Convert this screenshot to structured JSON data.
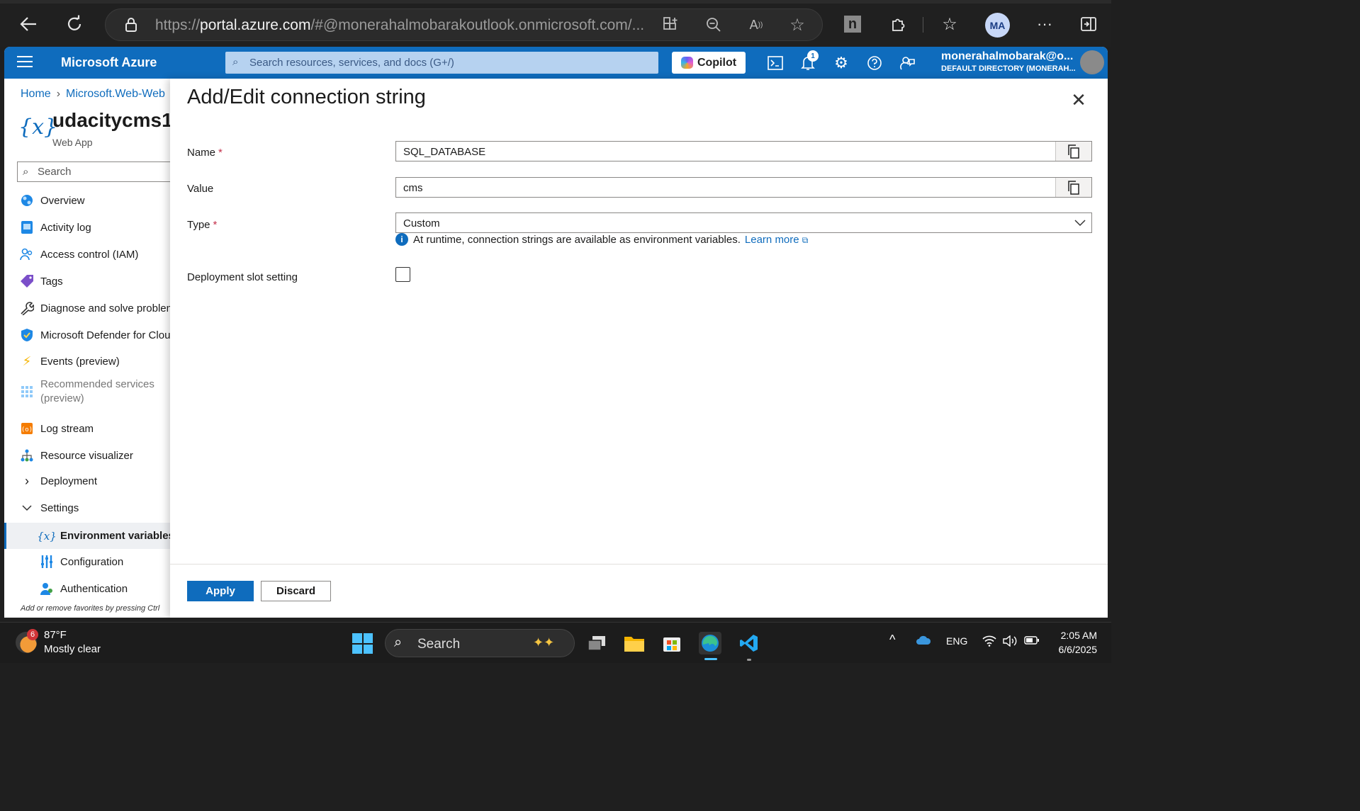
{
  "browser": {
    "url_prefix": "https://",
    "url_host": "portal.azure.com",
    "url_rest": "/#@monerahalmobarakoutlook.onmicrosoft.com/...",
    "profile_initials": "MA"
  },
  "header": {
    "brand": "Microsoft Azure",
    "search_placeholder": "Search resources, services, and docs (G+/)",
    "copilot_label": "Copilot",
    "notification_count": "1",
    "user_email": "monerahalmobarak@o...",
    "user_directory": "DEFAULT DIRECTORY (MONERAH..."
  },
  "breadcrumb": {
    "home": "Home",
    "resource_group": "Microsoft.Web-Web"
  },
  "resource": {
    "title": "udacitycms1 |",
    "subtitle": "Web App",
    "icon_glyph": "{x}"
  },
  "left_search": {
    "placeholder": "Search"
  },
  "nav": {
    "items": [
      {
        "label": "Overview",
        "icon": "globe-icon"
      },
      {
        "label": "Activity log",
        "icon": "activity-log-icon"
      },
      {
        "label": "Access control (IAM)",
        "icon": "people-icon"
      },
      {
        "label": "Tags",
        "icon": "tag-icon"
      },
      {
        "label": "Diagnose and solve problems",
        "icon": "wrench-icon"
      },
      {
        "label": "Microsoft Defender for Cloud",
        "icon": "shield-icon"
      },
      {
        "label": "Events (preview)",
        "icon": "lightning-icon"
      },
      {
        "label": "Recommended services",
        "label2": "(preview)",
        "icon": "grid-icon"
      },
      {
        "label": "Log stream",
        "icon": "log-stream-icon"
      },
      {
        "label": "Resource visualizer",
        "icon": "hierarchy-icon"
      },
      {
        "label": "Deployment",
        "icon": "chevron-right-icon"
      },
      {
        "label": "Settings",
        "icon": "chevron-down-icon"
      },
      {
        "label": "Environment variables",
        "icon": "variable-icon"
      },
      {
        "label": "Configuration",
        "icon": "sliders-icon"
      },
      {
        "label": "Authentication",
        "icon": "user-key-icon"
      }
    ],
    "hint": "Add or remove favorites by pressing Ctrl"
  },
  "panel": {
    "title": "Add/Edit connection string",
    "name_label": "Name",
    "name_value": "SQL_DATABASE",
    "value_label": "Value",
    "value_value": "cms",
    "type_label": "Type",
    "type_value": "Custom",
    "info_text": "At runtime, connection strings are available as environment variables.",
    "learn_more": "Learn more",
    "slot_label": "Deployment slot setting",
    "required_mark": "*",
    "apply_label": "Apply",
    "discard_label": "Discard"
  },
  "taskbar": {
    "weather_badge": "6",
    "temperature": "87°F",
    "condition": "Mostly clear",
    "search_label": "Search",
    "language": "ENG",
    "time": "2:05 AM",
    "date": "6/6/2025"
  },
  "colors": {
    "azure_blue": "#0f6cbd",
    "required_red": "#c4314b"
  }
}
